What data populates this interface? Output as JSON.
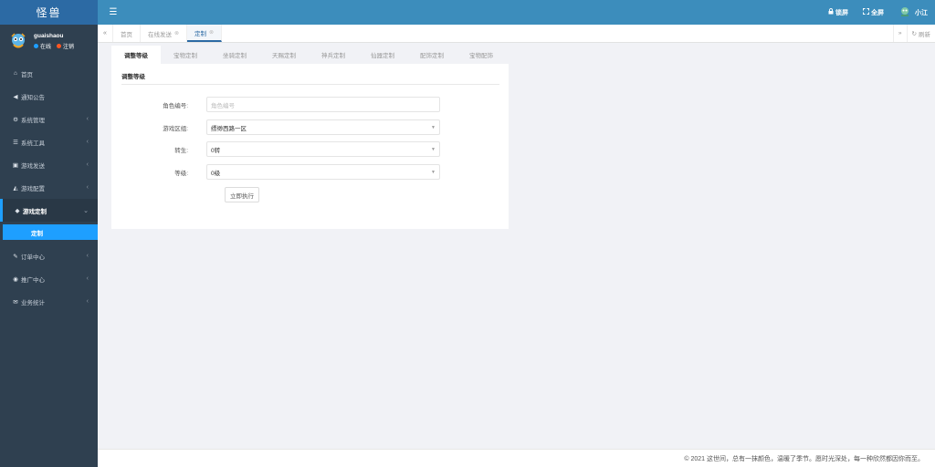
{
  "brand": {
    "title": "怪兽"
  },
  "user": {
    "name": "guaishaou",
    "online": "在线",
    "logout": "注销"
  },
  "sidebar": {
    "items": [
      {
        "icon": "home-icon",
        "glyph": "⌂",
        "label": "首页"
      },
      {
        "icon": "megaphone-icon",
        "glyph": "📢",
        "label": "通知公告"
      },
      {
        "icon": "gear-icon",
        "glyph": "⚙",
        "label": "系统管理"
      },
      {
        "icon": "list-icon",
        "glyph": "☰",
        "label": "系统工具"
      },
      {
        "icon": "gamepad-icon",
        "glyph": "▣",
        "label": "游戏发送"
      },
      {
        "icon": "car-icon",
        "glyph": "◭",
        "label": "游戏配置"
      },
      {
        "icon": "cube-icon",
        "glyph": "◆",
        "label": "游戏定制"
      },
      {
        "icon": "pencil-icon",
        "glyph": "✎",
        "label": "订单中心"
      },
      {
        "icon": "eye-icon",
        "glyph": "◉",
        "label": "推广中心"
      },
      {
        "icon": "envelope-icon",
        "glyph": "✉",
        "label": "业务统计"
      }
    ],
    "sub_item": "定制"
  },
  "topbar": {
    "menu_icon": "☰",
    "lock": "锁屏",
    "fullscreen": "全屏",
    "username": "小江"
  },
  "tabs": [
    {
      "label": "首页"
    },
    {
      "label": "在线发送"
    },
    {
      "label": "定制"
    }
  ],
  "tabbar": {
    "refresh": "刷新"
  },
  "subtabs": [
    "调整等级",
    "宝物定制",
    "坐骑定制",
    "天赐定制",
    "神兵定制",
    "仙器定制",
    "配饰定制",
    "宝物配饰"
  ],
  "form": {
    "title": "调整等级",
    "role_id": {
      "label": "角色编号:",
      "placeholder": "角色编号"
    },
    "zone": {
      "label": "游戏区组:",
      "value": "缥缈西路一区"
    },
    "rebirth": {
      "label": "转生:",
      "value": "0转"
    },
    "level": {
      "label": "等级:",
      "value": "0级"
    },
    "submit": "立即执行"
  },
  "footer": {
    "text": "© 2021 这世间，总有一抹颜色，温暖了季节。愿时光深处，每一种欣然都因你而至。"
  },
  "colors": {
    "sidebar": "#2f4050",
    "topbar": "#3c8dbc",
    "accent": "#1e9fff"
  }
}
